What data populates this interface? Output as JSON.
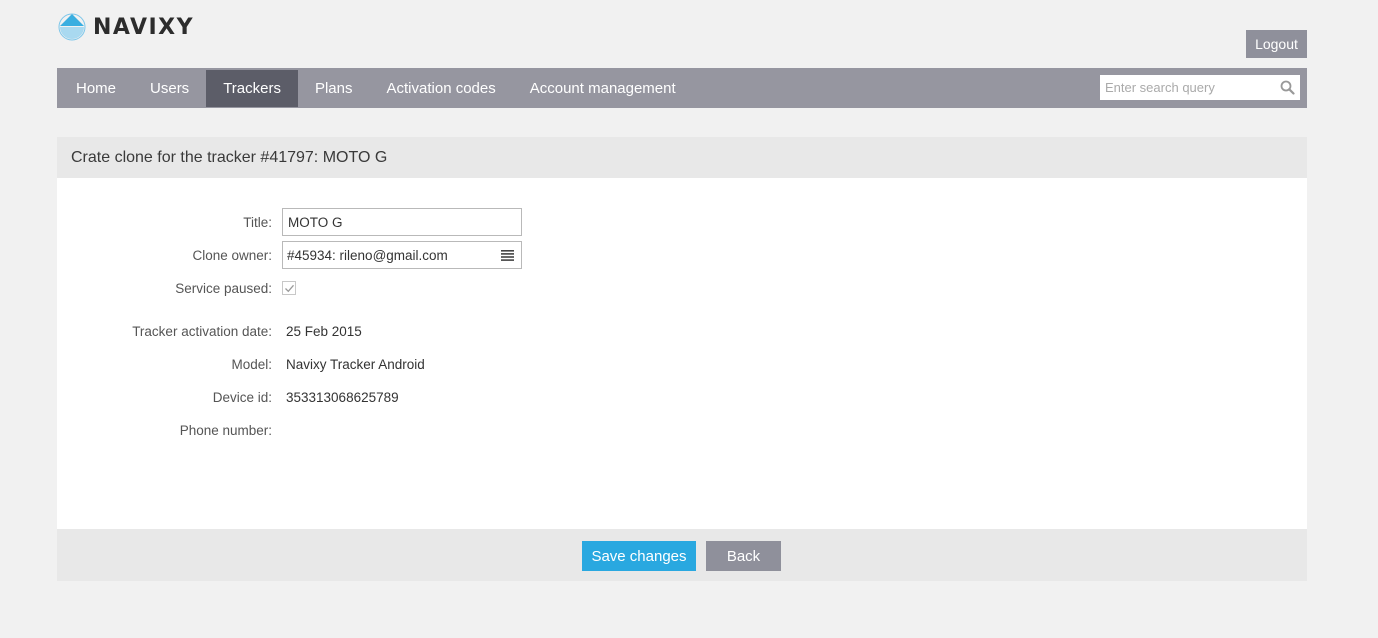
{
  "brand": {
    "name": "NAVIXY"
  },
  "header": {
    "logout_label": "Logout"
  },
  "nav": {
    "items": [
      {
        "label": "Home",
        "active": false
      },
      {
        "label": "Users",
        "active": false
      },
      {
        "label": "Trackers",
        "active": true
      },
      {
        "label": "Plans",
        "active": false
      },
      {
        "label": "Activation codes",
        "active": false
      },
      {
        "label": "Account management",
        "active": false
      }
    ],
    "search_placeholder": "Enter search query"
  },
  "panel": {
    "title": "Crate clone for the tracker #41797: MOTO G"
  },
  "form": {
    "title_label": "Title:",
    "title_value": "MOTO G",
    "owner_label": "Clone owner:",
    "owner_value": "#45934: rileno@gmail.com",
    "paused_label": "Service paused:",
    "paused_checked": true,
    "activation_label": "Tracker activation date:",
    "activation_value": "25 Feb 2015",
    "model_label": "Model:",
    "model_value": "Navixy Tracker Android",
    "device_label": "Device id:",
    "device_value": "353313068625789",
    "phone_label": "Phone number:",
    "phone_value": ""
  },
  "footer": {
    "save_label": "Save changes",
    "back_label": "Back"
  },
  "colors": {
    "nav_bg": "#9696a0",
    "nav_active": "#5c5d68",
    "primary": "#29a8e0",
    "secondary": "#8f909b"
  }
}
